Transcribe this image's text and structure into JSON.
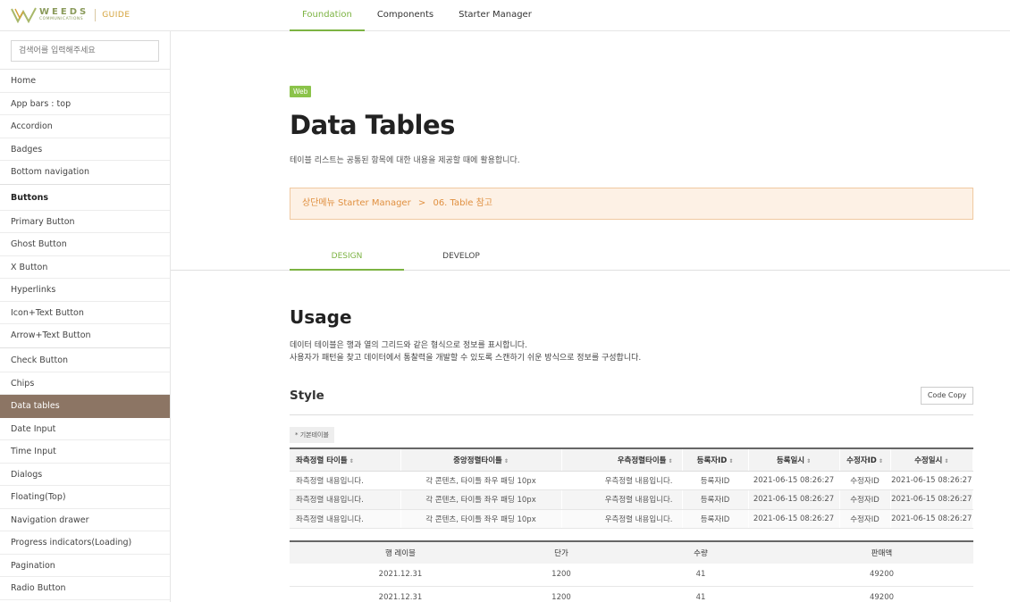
{
  "header": {
    "brand": "WEEDS",
    "brand_sub": "COMMUNICATIONS",
    "guide": "GUIDE",
    "nav": [
      "Foundation",
      "Components",
      "Starter Manager"
    ]
  },
  "sidebar": {
    "search_placeholder": "검색어를 입력해주세요",
    "items": [
      "Home",
      "App bars : top",
      "Accordion",
      "Badges",
      "Bottom navigation",
      "Buttons",
      "Primary Button",
      "Ghost Button",
      "X Button",
      "Hyperlinks",
      "Icon+Text Button",
      "Arrow+Text Button",
      "Check Button",
      "Chips",
      "Data tables",
      "Date Input",
      "Time Input",
      "Dialogs",
      "Floating(Top)",
      "Navigation drawer",
      "Progress indicators(Loading)",
      "Pagination",
      "Radio Button"
    ]
  },
  "main": {
    "badge": "Web",
    "title": "Data Tables",
    "desc": "테이블 리스트는 공통된 항목에 대한 내용을 제공할 때에 활용합니다.",
    "notice_left": "상단메뉴 Starter Manager",
    "notice_arrow": ">",
    "notice_right": "06. Table 참고",
    "tabs": [
      "DESIGN",
      "DEVELOP"
    ],
    "usage_title": "Usage",
    "usage_line1": "데이터 테이블은 행과 열의 그리드와 같은 형식으로 정보를 표시합니다.",
    "usage_line2": "사용자가 패턴을 찾고 데이터에서 통찰력을 개발할 수 있도록 스캔하기 쉬운 방식으로 정보를 구성합니다.",
    "style_title": "Style",
    "code_copy": "Code Copy",
    "table_chip": "* 기본테이블",
    "sort_icon": "⇕"
  },
  "table1": {
    "headers": [
      "좌측정렬 타이틀",
      "중앙정렬타이틀",
      "우측정렬타이틀",
      "등록자ID",
      "등록일시",
      "수정자ID",
      "수정일시"
    ],
    "rows": [
      [
        "좌측정렬 내용입니다.",
        "각 콘텐츠, 타이틀 좌우 패딩 10px",
        "우측정렬 내용입니다.",
        "등록자ID",
        "2021-06-15 08:26:27",
        "수정자ID",
        "2021-06-15 08:26:27"
      ],
      [
        "좌측정렬 내용입니다.",
        "각 콘텐츠, 타이틀 좌우 패딩 10px",
        "우측정렬 내용입니다.",
        "등록자ID",
        "2021-06-15 08:26:27",
        "수정자ID",
        "2021-06-15 08:26:27"
      ],
      [
        "좌측정렬 내용입니다.",
        "각 콘텐츠, 타이틀 좌우 패딩 10px",
        "우측정렬 내용입니다.",
        "등록자ID",
        "2021-06-15 08:26:27",
        "수정자ID",
        "2021-06-15 08:26:27"
      ]
    ]
  },
  "table2": {
    "headers": [
      "행 레이블",
      "단가",
      "수량",
      "판매액"
    ],
    "rows": [
      [
        "2021.12.31",
        "1200",
        "41",
        "49200"
      ],
      [
        "2021.12.31",
        "1200",
        "41",
        "49200"
      ]
    ]
  },
  "colors": {
    "accent": "#7cb342",
    "sidebar_active": "#8c7564",
    "notice_text": "#e09040",
    "notice_bg": "#fdf1e5"
  }
}
